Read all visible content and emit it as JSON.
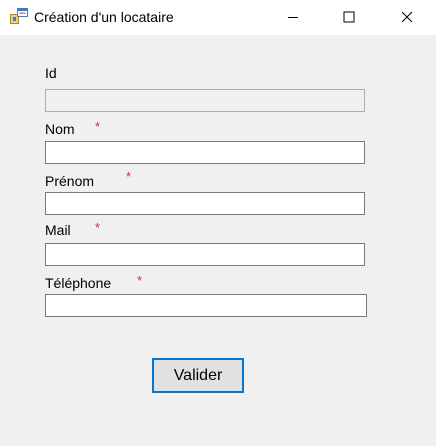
{
  "window": {
    "title": "Création d'un locataire",
    "icon": "winforms-app-icon",
    "controls": {
      "minimize_icon": "minimize-icon",
      "maximize_icon": "maximize-icon",
      "close_icon": "close-icon"
    }
  },
  "form": {
    "fields": [
      {
        "key": "id",
        "label": "Id",
        "required": false,
        "readonly": true,
        "value": ""
      },
      {
        "key": "nom",
        "label": "Nom",
        "required": true,
        "readonly": false,
        "value": ""
      },
      {
        "key": "prenom",
        "label": "Prénom",
        "required": true,
        "readonly": false,
        "value": ""
      },
      {
        "key": "mail",
        "label": "Mail",
        "required": true,
        "readonly": false,
        "value": ""
      },
      {
        "key": "telephone",
        "label": "Téléphone",
        "required": true,
        "readonly": false,
        "value": ""
      }
    ],
    "required_marker": "*",
    "submit_label": "Valider"
  },
  "colors": {
    "required_marker": "#e0262a",
    "button_border": "#0078d7",
    "background": "#f0f0f0"
  }
}
